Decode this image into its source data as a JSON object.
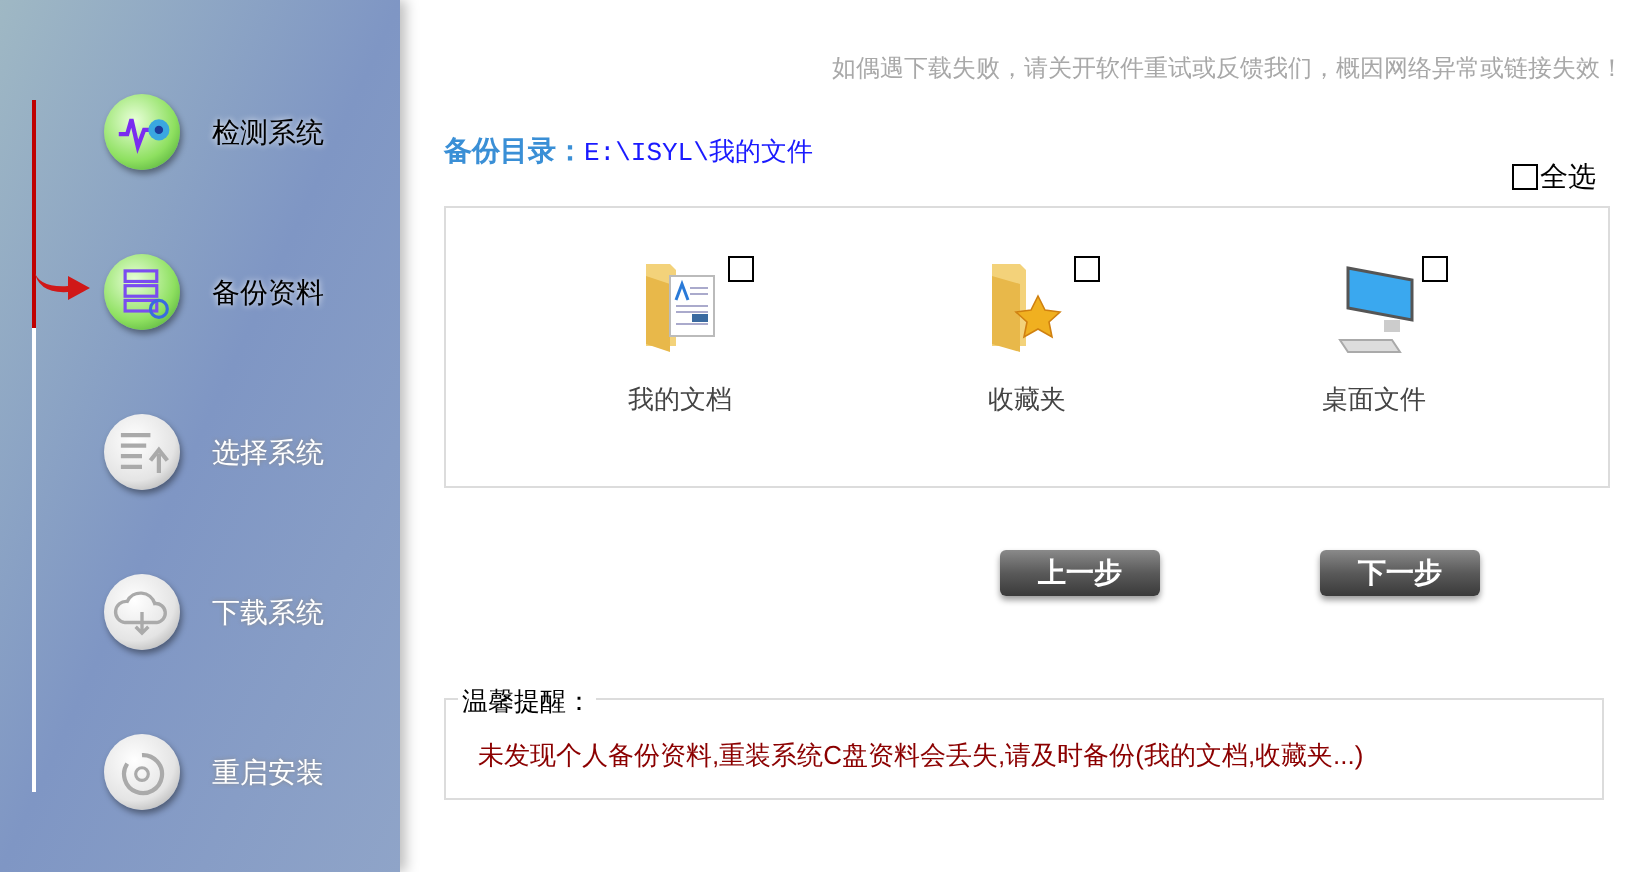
{
  "steps": [
    {
      "label": "检测系统",
      "active": true,
      "selected": false,
      "kind": "detect"
    },
    {
      "label": "备份资料",
      "active": true,
      "selected": true,
      "kind": "backup"
    },
    {
      "label": "选择系统",
      "active": false,
      "selected": false,
      "kind": "select"
    },
    {
      "label": "下载系统",
      "active": false,
      "selected": false,
      "kind": "download"
    },
    {
      "label": "重启安装",
      "active": false,
      "selected": false,
      "kind": "restart"
    }
  ],
  "notice": "如偶遇下载失败，请关开软件重试或反馈我们，概因网络异常或链接失效！",
  "backup_dir": {
    "label": "备份目录：",
    "path": "E:\\ISYL\\我的文件"
  },
  "select_all": {
    "label": "全选",
    "checked": false
  },
  "folders": [
    {
      "label": "我的文档",
      "kind": "documents",
      "checked": false
    },
    {
      "label": "收藏夹",
      "kind": "favorites",
      "checked": false
    },
    {
      "label": "桌面文件",
      "kind": "desktop",
      "checked": false
    }
  ],
  "buttons": [
    {
      "label": "上一步"
    },
    {
      "label": "下一步"
    }
  ],
  "tip": {
    "legend": "温馨提醒：",
    "message": "未发现个人备份资料,重装系统C盘资料会丢失,请及时备份(我的文档,收藏夹...)"
  }
}
